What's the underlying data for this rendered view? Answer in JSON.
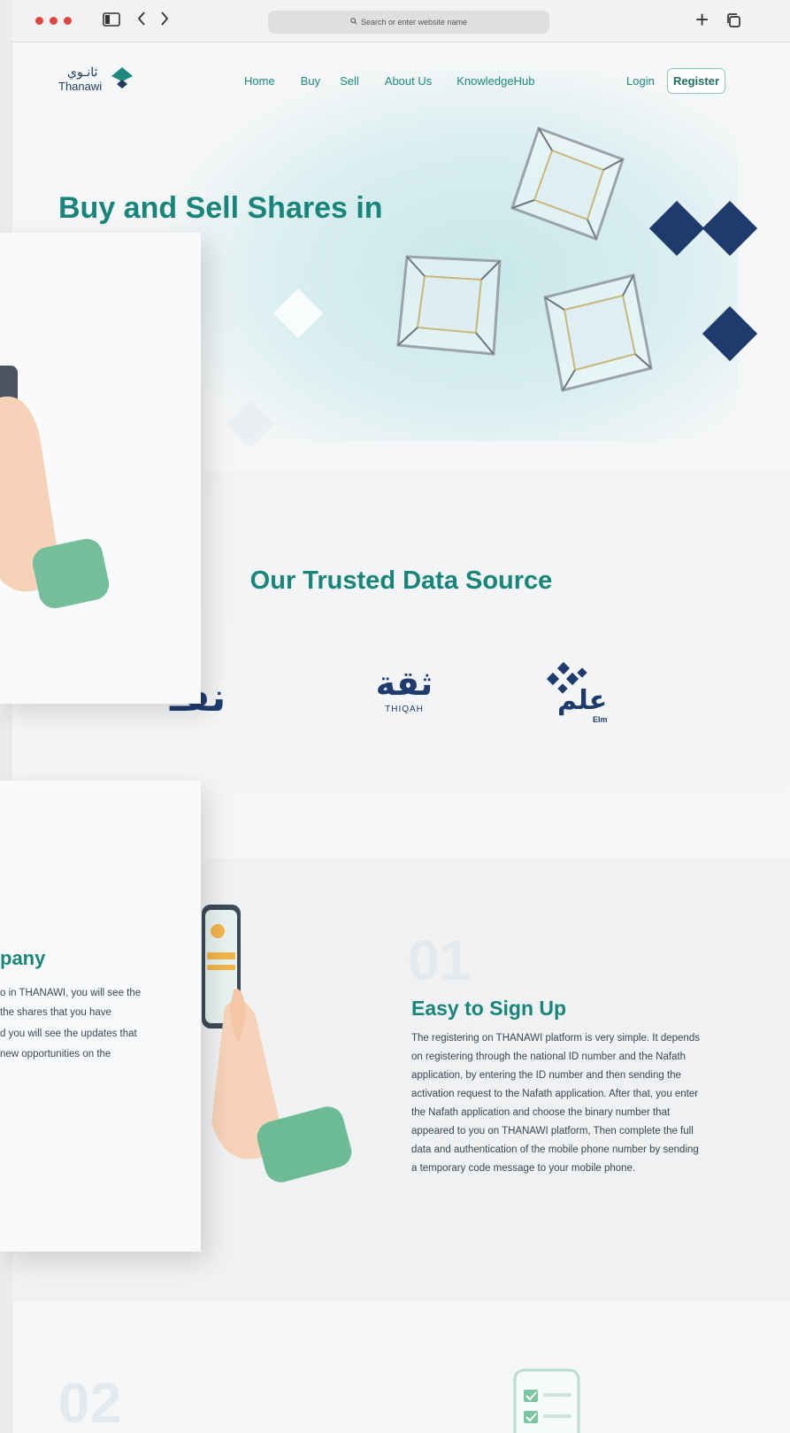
{
  "browser": {
    "address_placeholder": "Search or enter website name"
  },
  "nav": {
    "logo_arabic": "ثانـوي",
    "logo_english": "Thanawi",
    "links": [
      "Home",
      "Buy",
      "Sell",
      "About Us",
      "KnowledgeHub"
    ],
    "login": "Login",
    "register": "Register"
  },
  "hero": {
    "title": "Buy and Sell Shares in"
  },
  "trusted": {
    "title": "Our Trusted Data Source",
    "partners": [
      {
        "name_ar": "نفـ",
        "label": ""
      },
      {
        "name_ar": "ثقة",
        "label": "THIQAH"
      },
      {
        "name_ar": "علم",
        "label": "Elm"
      }
    ]
  },
  "steps": [
    {
      "number": "01",
      "title": "Easy to Sign Up",
      "description_lines": [
        "The registering on THANAWI platform is very simple. It depends",
        "on registering through the national ID number and the Nafath",
        "application, by entering the ID number and then sending the",
        "activation request to the Nafath application. After that, you enter",
        "the Nafath application and choose the binary number that",
        "appeared to you on THANAWI platform, Then complete the full",
        "data and authentication of the mobile phone number by sending",
        "a temporary code message to your mobile phone."
      ]
    },
    {
      "number": "02"
    }
  ],
  "side_card": {
    "heading": "pany",
    "lines": [
      "o in THANAWI, you will see the",
      "the shares that you have",
      "d you will see the updates that",
      "new opportunities on the"
    ]
  },
  "colors": {
    "brand_teal": "#17857a",
    "brand_navy": "#1f3b5c",
    "accent_green": "#7cc4a2"
  }
}
